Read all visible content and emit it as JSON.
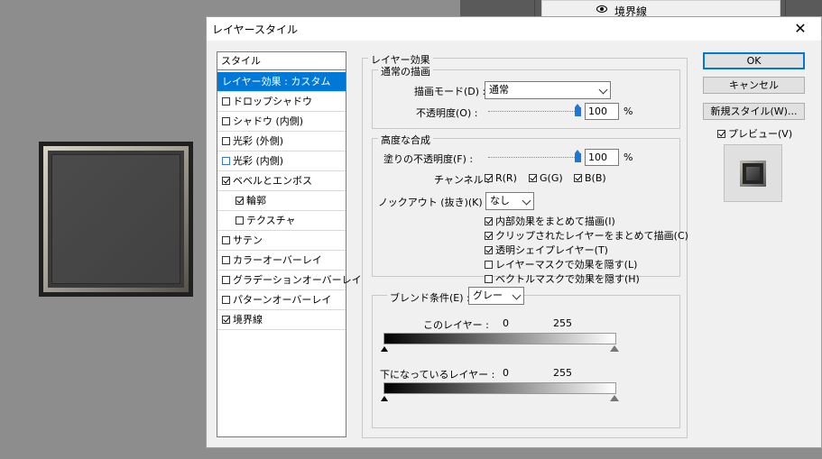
{
  "background": {
    "layer_label": "境界線",
    "layer_visibility_icon": "eye-icon"
  },
  "dialog": {
    "title": "レイヤースタイル",
    "close_icon": "close-icon"
  },
  "style_list": {
    "header": "スタイル",
    "items": [
      {
        "label": "レイヤー効果 : カスタム",
        "checkbox": null,
        "selected": true
      },
      {
        "label": "ドロップシャドウ",
        "checkbox": false
      },
      {
        "label": "シャドウ (内側)",
        "checkbox": false
      },
      {
        "label": "光彩 (外側)",
        "checkbox": false
      },
      {
        "label": "光彩 (内側)",
        "checkbox": false
      },
      {
        "label": "ベベルとエンボス",
        "checkbox": true
      },
      {
        "label": "輪郭",
        "checkbox": true,
        "indent": true
      },
      {
        "label": "テクスチャ",
        "checkbox": false,
        "indent": true
      },
      {
        "label": "サテン",
        "checkbox": false
      },
      {
        "label": "カラーオーバーレイ",
        "checkbox": false
      },
      {
        "label": "グラデーションオーバーレイ",
        "checkbox": false
      },
      {
        "label": "パターンオーバーレイ",
        "checkbox": false
      },
      {
        "label": "境界線",
        "checkbox": true
      }
    ]
  },
  "effects": {
    "section_title": "レイヤー効果",
    "general": {
      "title": "通常の描画",
      "blend_mode_label": "描画モード(D) :",
      "blend_mode_value": "通常",
      "opacity_label": "不透明度(O) :",
      "opacity_value": "100",
      "opacity_unit": "%",
      "opacity_fraction": 1.0
    },
    "advanced": {
      "title": "高度な合成",
      "fill_opacity_label": "塗りの不透明度(F) :",
      "fill_opacity_value": "100",
      "fill_opacity_unit": "%",
      "fill_opacity_fraction": 1.0,
      "channels_label": "チャンネル :",
      "channel_r": "R(R)",
      "channel_g": "G(G)",
      "channel_b": "B(B)",
      "knockout_label": "ノックアウト (抜き)(K) :",
      "knockout_value": "なし",
      "options": [
        {
          "label": "内部効果をまとめて描画(I)",
          "checked": true
        },
        {
          "label": "クリップされたレイヤーをまとめて描画(C)",
          "checked": true
        },
        {
          "label": "透明シェイプレイヤー(T)",
          "checked": true
        },
        {
          "label": "レイヤーマスクで効果を隠す(L)",
          "checked": false
        },
        {
          "label": "ベクトルマスクで効果を隠す(H)",
          "checked": false
        }
      ]
    },
    "blend_if": {
      "label": "ブレンド条件(E) :",
      "value": "グレー",
      "this_layer_label": "このレイヤー :",
      "this_layer_min": "0",
      "this_layer_max": "255",
      "underlying_label": "下になっているレイヤー :",
      "underlying_min": "0",
      "underlying_max": "255"
    }
  },
  "buttons": {
    "ok": "OK",
    "cancel": "キャンセル",
    "new_style": "新規スタイル(W)...",
    "preview": "プレビュー(V)"
  }
}
